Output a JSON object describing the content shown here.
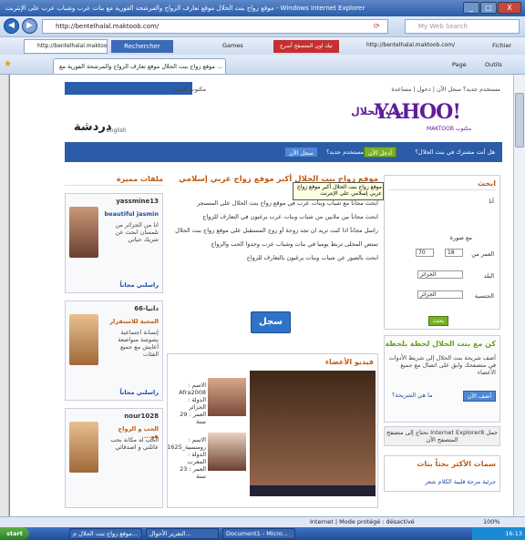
{
  "window": {
    "title": "موقع زواج بنت الحلال موقع تعارف الزواج والمرشحة الفورية مع بنات عرب وشباب عرب على الإنترنت - Windows Internet Explorer",
    "min": "_",
    "max": "□",
    "close": "X"
  },
  "addressbar": {
    "url": "http://bentelhalal.maktoob.com/",
    "search_placeholder": "My Web Search"
  },
  "toolbar": {
    "url2": "http://bentelhalal.maktoob.com/",
    "rechercher": "Rechercher",
    "games": "Games",
    "promo": "تيك اون المتصفح أسرع",
    "url3": "http://bentelhalal.maktoob.com/",
    "fichier": "Fichier"
  },
  "tabbar": {
    "active_tab": "موقع زواج بنت الحلال موقع تعارف الزواج والمرشحة الفورية مع ...",
    "page_btn": "Page",
    "outils": "Outils"
  },
  "page": {
    "top_links": "مستخدم جديد؟ سجل الآن | دخول | مساعدة",
    "mail_links": "مكتوب البريد",
    "logo": "YAHOO!",
    "logo_sub": "MAKTOOB مكتوب",
    "site_name": "بنت الحلال",
    "daradsha": "دردشة",
    "english": "English",
    "nav_question": "هل أنت مشترك في بنت الحلال؟",
    "nav_login": "أدخل الآن",
    "nav_new": "مستخدم جديد؟",
    "nav_register": "سجل الآن",
    "featured_title": "ملفات مميزة",
    "profiles": [
      {
        "name": "yassmine13",
        "headline": "beautiful jasmin",
        "desc": "انا من الجزائر من تلمسان ابحث عن شريك حياتي",
        "link": "راسلني مجاناً"
      },
      {
        "name": "دانيا-66",
        "headline": "المحبة للاستقرار",
        "desc": "إنسانة اجتماعية بشوشة متواضعة أعايش مع جميع الفئات",
        "link": "راسلني مجاناً"
      },
      {
        "name": "nour1028",
        "headline": "الحب و الزواج هو...",
        "desc": "الحب له مكانة بحب عائلتي و اصدقائي",
        "link": ""
      }
    ],
    "main_title": "موقع زواج بنت الحلال أكبر موقع زواج عربي إسلامي على الإنترنت !",
    "bullets": [
      "ابحث مجاناً مع شباب وبنات عرب في موقع زواج بنت الحلال على المسنجر",
      "ابحث مجاناً بين ملايين من شباب وبنات عرب يرغبون في التعارف للزواج",
      "راسل مجاناً اذا كنت تريد ان تجد زوجة أو زوج المستقبل على موقع زواج بنت الحلال",
      "تمتص المحلى تربط يوميا في بنات وشباب عرب وحدوا الحب والزواج",
      "ابحث بالصور عن شباب وبنات يرغبون بالتعارف للزواج"
    ],
    "register_btn": "سجل الآن",
    "tooltip": "موقع زواج بنت الحلال أكبر موقع زواج عربي إسلامي على الإنترنت",
    "video_title": "فيديو الأعضاء",
    "video_members": [
      {
        "name": "الاسم : Afra2008",
        "country": "الدولة : الجزائر",
        "age": "العمر : 29 سنة"
      },
      {
        "name": "الاسم : رومنسية_1625",
        "country": "الدولة : المغرب",
        "age": "العمر : 23 سنة"
      }
    ],
    "search_title": "ابحث",
    "search": {
      "gender_label": "أنا",
      "with_photo": "مع صورة",
      "age_label": "العمر من",
      "age_from": "18",
      "age_to": "70",
      "country_label": "البلد",
      "country_val": "الجزائر",
      "nationality_label": "الجنسية",
      "nationality_val": "الجزائر",
      "go": "بحث"
    },
    "promo_title": "كن مع بنت الحلال لحظة بلحظة",
    "promo_text": "أضف شريحة بنت الحلال إلى شريط الأدوات في متصفحك وابق على اتصال مع جميع الأعضاء",
    "promo_add": "أضف الآن",
    "promo_what": "ما هي الشريحة؟",
    "ie_update": "تحتاج إلى متصفح Internet Explorer8 حمل المتصفح الآن",
    "features_title": "سمات الأكثر بحثاً بنات",
    "features_links": "جرئية مرحة قلبية الكلام شعر"
  },
  "status": {
    "text": "Internet | Mode protégé : désactivé",
    "zoom": "100%"
  },
  "taskbar": {
    "start": "start",
    "tab1": "موقع زواج بنت الحلال م...",
    "tab2": "التقرير الأحوال...",
    "tab3": "Document1 - Micro...",
    "clock": "16:13"
  }
}
